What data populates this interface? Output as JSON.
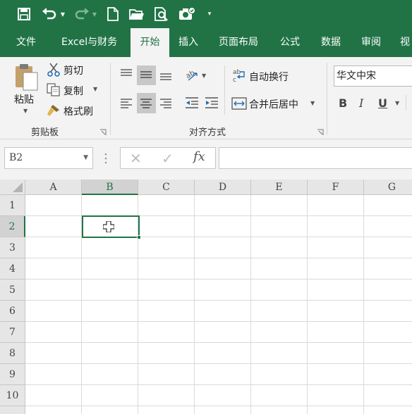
{
  "quick_access": {
    "icons": [
      "save-icon",
      "undo-icon",
      "redo-icon",
      "new-file-icon",
      "open-folder-icon",
      "print-preview-icon",
      "camera-icon",
      "customize-icon"
    ]
  },
  "tabs": [
    {
      "label": "文件"
    },
    {
      "label": "Excel与财务"
    },
    {
      "label": "开始",
      "active": true
    },
    {
      "label": "插入"
    },
    {
      "label": "页面布局"
    },
    {
      "label": "公式"
    },
    {
      "label": "数据"
    },
    {
      "label": "审阅"
    },
    {
      "label": "视"
    }
  ],
  "clipboard": {
    "paste_label": "粘贴",
    "cut_label": "剪切",
    "copy_label": "复制",
    "format_painter_label": "格式刷",
    "group_label": "剪贴板"
  },
  "alignment": {
    "wrap_text_label": "自动换行",
    "merge_center_label": "合并后居中",
    "group_label": "对齐方式"
  },
  "font": {
    "name": "华文中宋",
    "bold": "B",
    "italic": "I",
    "underline": "U"
  },
  "formula_bar": {
    "name_box": "B2",
    "cancel": "✕",
    "enter": "✓",
    "fx": "fx",
    "formula": ""
  },
  "sheet": {
    "columns": [
      "A",
      "B",
      "C",
      "D",
      "E",
      "F",
      "G"
    ],
    "rows": [
      "1",
      "2",
      "3",
      "4",
      "5",
      "6",
      "7",
      "8",
      "9",
      "10"
    ],
    "active_cell": "B2"
  },
  "colors": {
    "brand": "#217346",
    "ribbon_bg": "#f3f3f3",
    "header_bg": "#e6e6e6",
    "selected_header_bg": "#d2d2d2"
  }
}
